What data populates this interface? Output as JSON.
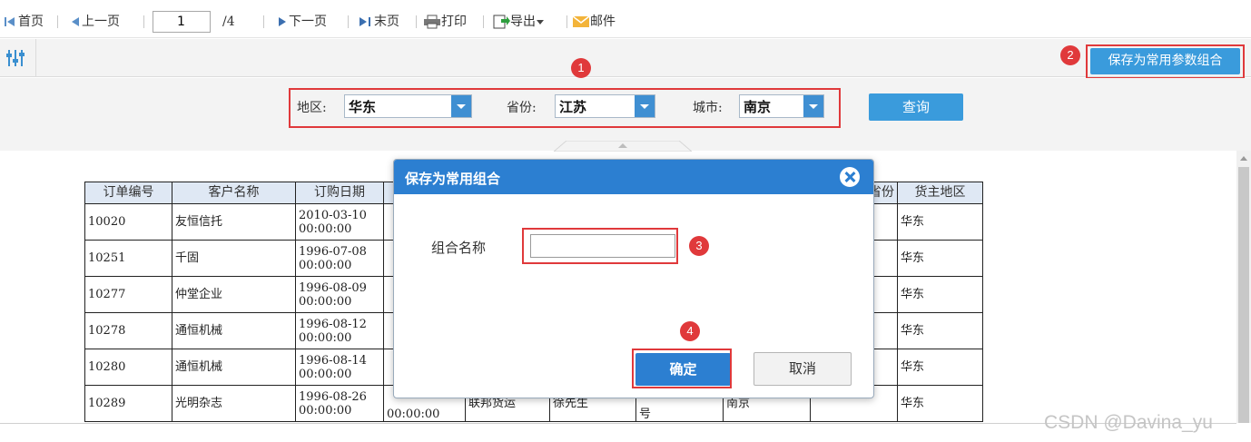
{
  "toolbar": {
    "first_page": "首页",
    "prev_page": "上一页",
    "page_number": "1",
    "page_total": "/4",
    "next_page": "下一页",
    "last_page": "末页",
    "print": "打印",
    "export": "导出",
    "mail": "邮件"
  },
  "param_bar": {
    "save_combo_button": "保存为常用参数组合"
  },
  "filters": {
    "region_label": "地区:",
    "region_value": "华东",
    "province_label": "省份:",
    "province_value": "江苏",
    "city_label": "城市:",
    "city_value": "南京",
    "query_button": "查询"
  },
  "badges": [
    "1",
    "2",
    "3",
    "4"
  ],
  "table": {
    "headers": [
      "订单编号",
      "客户名称",
      "订购日期",
      "",
      "",
      "",
      "",
      "",
      "省份",
      "货主地区"
    ],
    "rows": [
      [
        "10020",
        "友恒信托",
        "2010-03-10 00:00:00",
        "",
        "",
        "",
        "",
        "",
        "",
        "华东"
      ],
      [
        "10251",
        "千固",
        "1996-07-08 00:00:00",
        "",
        "",
        "",
        "",
        "",
        "",
        "华东"
      ],
      [
        "10277",
        "仲堂企业",
        "1996-08-09 00:00:00",
        "",
        "",
        "",
        "",
        "",
        "",
        "华东"
      ],
      [
        "10278",
        "通恒机械",
        "1996-08-12 00:00:00",
        "",
        "",
        "",
        "",
        "",
        "",
        "华东"
      ],
      [
        "10280",
        "通恒机械",
        "1996-08-14 00:00:00",
        "",
        "",
        "",
        "",
        "",
        "",
        "华东"
      ],
      [
        "10289",
        "光明杂志",
        "1996-08-26 00:00:00",
        "00:00:00",
        "联邦货运",
        "徐先生",
        "号",
        "南京",
        "",
        "华东"
      ]
    ]
  },
  "dialog": {
    "title": "保存为常用组合",
    "name_label": "组合名称",
    "name_value": "",
    "ok_button": "确定",
    "cancel_button": "取消"
  },
  "watermark": "CSDN @Davina_yu",
  "colors": {
    "accent_blue": "#3a9bdc",
    "dialog_header": "#2c7fd1",
    "highlight_red": "#e0393b",
    "table_header_bg": "#dfe8f4"
  }
}
